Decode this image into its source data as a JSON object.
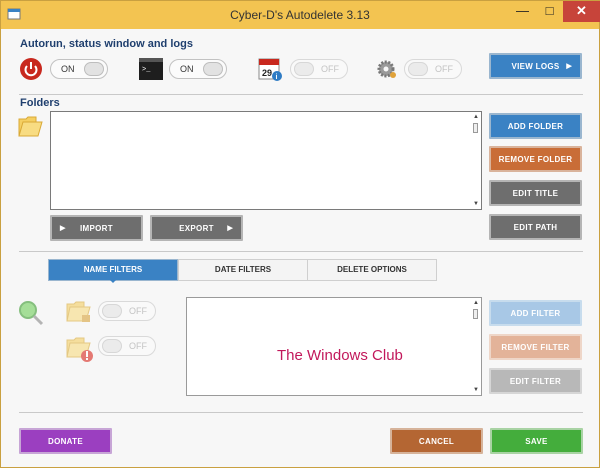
{
  "window": {
    "title": "Cyber-D's Autodelete 3.13",
    "minimize": "—",
    "maximize": "□",
    "close": "✕"
  },
  "autorun": {
    "section_title": "Autorun, status window and logs",
    "toggles": [
      {
        "icon": "power-icon",
        "state": "ON"
      },
      {
        "icon": "terminal-icon",
        "state": "ON"
      },
      {
        "icon": "calendar-icon",
        "state": "OFF"
      },
      {
        "icon": "gear-icon",
        "state": "OFF"
      }
    ],
    "view_logs_label": "VIEW LOGS"
  },
  "folders": {
    "section_title": "Folders",
    "add_label": "ADD FOLDER",
    "remove_label": "REMOVE FOLDER",
    "edit_title_label": "EDIT TITLE",
    "edit_path_label": "EDIT PATH",
    "import_label": "IMPORT",
    "export_label": "EXPORT"
  },
  "tabs": [
    {
      "label": "NAME FILTERS",
      "active": true
    },
    {
      "label": "DATE FILTERS",
      "active": false
    },
    {
      "label": "DELETE OPTIONS",
      "active": false
    }
  ],
  "filters": {
    "toggle1_state": "OFF",
    "toggle2_state": "OFF",
    "add_label": "ADD FILTER",
    "remove_label": "REMOVE FILTER",
    "edit_label": "EDIT FILTER",
    "watermark": "The Windows Club"
  },
  "footer": {
    "donate_label": "DONATE",
    "cancel_label": "CANCEL",
    "save_label": "SAVE"
  },
  "colors": {
    "titlebar": "#f3c451",
    "accent_blue": "#3a82c4",
    "orange": "#c96d37",
    "green": "#44ad3c",
    "purple": "#9b3fc0"
  }
}
